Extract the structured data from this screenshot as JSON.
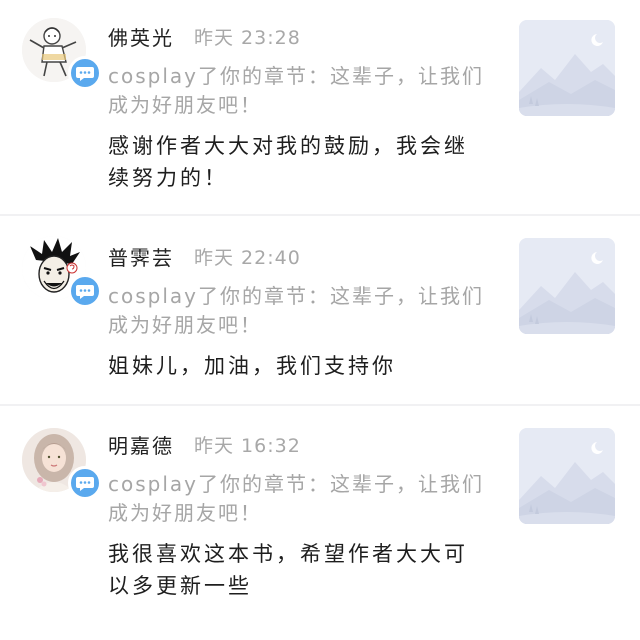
{
  "notifications": [
    {
      "username": "佛英光",
      "time": "昨天 23:28",
      "notice": "cosplay了你的章节：这辈子，让我们成为好朋友吧！",
      "reply": "感谢作者大大对我的鼓励，我会继续努力的！",
      "avatar_icon": "cartoon-character-avatar",
      "badge_icon": "comment-bubble-icon",
      "thumbnail_icon": "mountain-landscape-placeholder-icon"
    },
    {
      "username": "普霁芸",
      "time": "昨天 22:40",
      "notice": "cosplay了你的章节：这辈子，让我们成为好朋友吧！",
      "reply": "姐妹儿，加油，我们支持你",
      "avatar_icon": "sketch-face-avatar",
      "badge_icon": "comment-bubble-icon",
      "thumbnail_icon": "mountain-landscape-placeholder-icon"
    },
    {
      "username": "明嘉德",
      "time": "昨天 16:32",
      "notice": "cosplay了你的章节：这辈子，让我们成为好朋友吧！",
      "reply": "我很喜欢这本书，希望作者大大可以多更新一些",
      "avatar_icon": "girl-photo-avatar",
      "badge_icon": "comment-bubble-icon",
      "thumbnail_icon": "mountain-landscape-placeholder-icon"
    }
  ],
  "colors": {
    "badge": "#5aa9ee",
    "username": "#222222",
    "muted_text": "#a6a6a6",
    "thumbnail_bg": "#e6eaf4"
  }
}
